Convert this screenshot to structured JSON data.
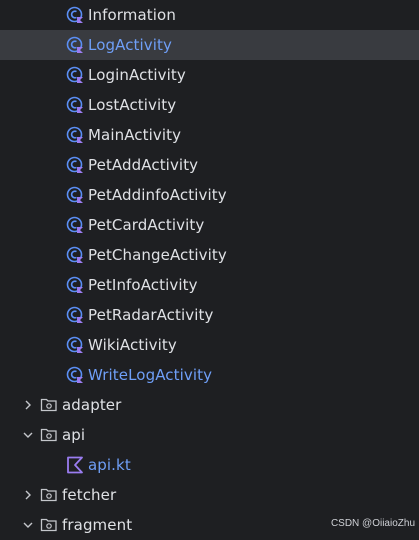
{
  "colors": {
    "background": "#1e1f22",
    "selected_row": "#393b40",
    "text": "#dfe1e5",
    "modified_text": "#6f9ff7",
    "class_icon": "#5b8ff5",
    "kotlin_icon": "#9a7cf0"
  },
  "tree": {
    "activities": [
      {
        "label": "Information",
        "icon": "kotlin-class-icon",
        "modified": false,
        "selected": false
      },
      {
        "label": "LogActivity",
        "icon": "kotlin-class-icon",
        "modified": true,
        "selected": true
      },
      {
        "label": "LoginActivity",
        "icon": "kotlin-class-icon",
        "modified": false,
        "selected": false
      },
      {
        "label": "LostActivity",
        "icon": "kotlin-class-icon",
        "modified": false,
        "selected": false
      },
      {
        "label": "MainActivity",
        "icon": "kotlin-class-icon",
        "modified": false,
        "selected": false
      },
      {
        "label": "PetAddActivity",
        "icon": "kotlin-class-icon",
        "modified": false,
        "selected": false
      },
      {
        "label": "PetAddinfoActivity",
        "icon": "kotlin-class-icon",
        "modified": false,
        "selected": false
      },
      {
        "label": "PetCardActivity",
        "icon": "kotlin-class-icon",
        "modified": false,
        "selected": false
      },
      {
        "label": "PetChangeActivity",
        "icon": "kotlin-class-icon",
        "modified": false,
        "selected": false
      },
      {
        "label": "PetInfoActivity",
        "icon": "kotlin-class-icon",
        "modified": false,
        "selected": false
      },
      {
        "label": "PetRadarActivity",
        "icon": "kotlin-class-icon",
        "modified": false,
        "selected": false
      },
      {
        "label": "WikiActivity",
        "icon": "kotlin-class-icon",
        "modified": false,
        "selected": false
      },
      {
        "label": "WriteLogActivity",
        "icon": "kotlin-class-icon",
        "modified": true,
        "selected": false
      }
    ],
    "folders": {
      "adapter": {
        "label": "adapter",
        "expanded": false
      },
      "api": {
        "label": "api",
        "expanded": true
      },
      "api_file": {
        "label": "api.kt",
        "icon": "kotlin-file-icon",
        "modified": true
      },
      "fetcher": {
        "label": "fetcher",
        "expanded": false
      },
      "fragment": {
        "label": "fragment",
        "expanded": true
      }
    }
  },
  "watermark": "CSDN @OiiaioZhu"
}
